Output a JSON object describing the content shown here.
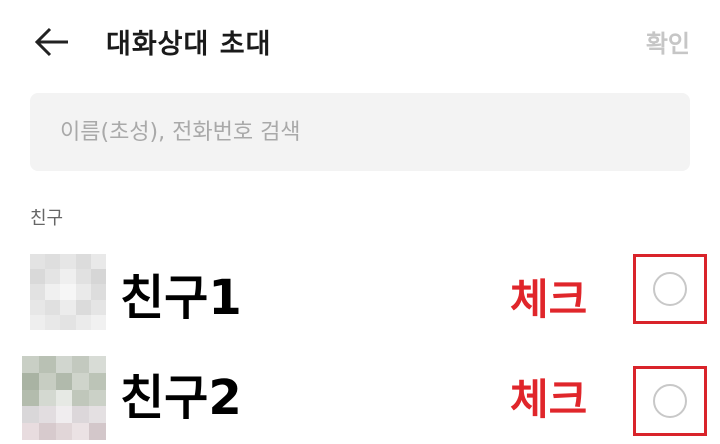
{
  "header": {
    "title": "대화상대 초대",
    "confirm_label": "확인"
  },
  "search": {
    "placeholder": "이름(초성), 전화번호 검색",
    "value": ""
  },
  "section": {
    "label": "친구"
  },
  "friends": [
    {
      "name": "친구1",
      "annotation": "체크",
      "checked": false
    },
    {
      "name": "친구2",
      "annotation": "체크",
      "checked": false
    }
  ],
  "colors": {
    "annotation": "#e0262b",
    "confirm_disabled": "#c6c6c6",
    "search_bg": "#f3f3f3"
  },
  "icons": {
    "back": "arrow-left-icon",
    "radio": "radio-unchecked-icon"
  }
}
